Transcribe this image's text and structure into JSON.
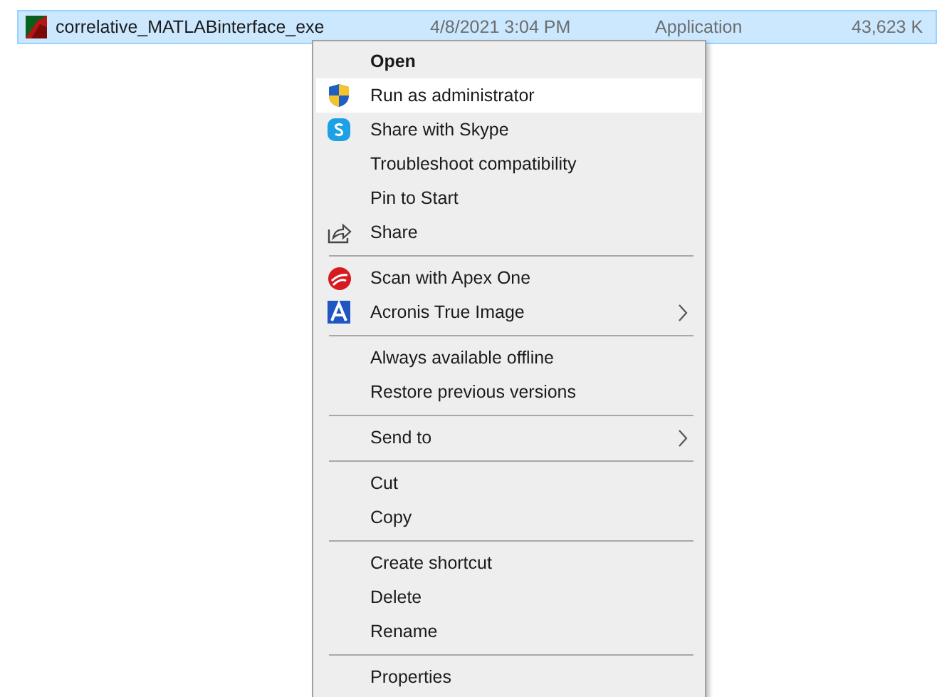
{
  "file_row": {
    "selected": true,
    "name": "correlative_MATLABinterface_exe",
    "date": "4/8/2021 3:04 PM",
    "type": "Application",
    "size": "43,623 K"
  },
  "context_menu": {
    "groups": [
      [
        {
          "label": "Open",
          "kind": "plain",
          "default": true,
          "selected": false,
          "submenu": false
        },
        {
          "label": "Run as administrator",
          "kind": "shield",
          "default": false,
          "selected": true,
          "submenu": false
        },
        {
          "label": "Share with Skype",
          "kind": "skype",
          "default": false,
          "selected": false,
          "submenu": false
        },
        {
          "label": "Troubleshoot compatibility",
          "kind": "plain",
          "default": false,
          "selected": false,
          "submenu": false
        },
        {
          "label": "Pin to Start",
          "kind": "plain",
          "default": false,
          "selected": false,
          "submenu": false
        },
        {
          "label": "Share",
          "kind": "share",
          "default": false,
          "selected": false,
          "submenu": false
        }
      ],
      [
        {
          "label": "Scan with Apex One",
          "kind": "apex",
          "default": false,
          "selected": false,
          "submenu": false
        },
        {
          "label": "Acronis True Image",
          "kind": "acronis",
          "default": false,
          "selected": false,
          "submenu": true
        }
      ],
      [
        {
          "label": "Always available offline",
          "kind": "plain",
          "default": false,
          "selected": false,
          "submenu": false
        },
        {
          "label": "Restore previous versions",
          "kind": "plain",
          "default": false,
          "selected": false,
          "submenu": false
        }
      ],
      [
        {
          "label": "Send to",
          "kind": "plain",
          "default": false,
          "selected": false,
          "submenu": true
        }
      ],
      [
        {
          "label": "Cut",
          "kind": "plain",
          "default": false,
          "selected": false,
          "submenu": false
        },
        {
          "label": "Copy",
          "kind": "plain",
          "default": false,
          "selected": false,
          "submenu": false
        }
      ],
      [
        {
          "label": "Create shortcut",
          "kind": "plain",
          "default": false,
          "selected": false,
          "submenu": false
        },
        {
          "label": "Delete",
          "kind": "plain",
          "default": false,
          "selected": false,
          "submenu": false
        },
        {
          "label": "Rename",
          "kind": "plain",
          "default": false,
          "selected": false,
          "submenu": false
        }
      ],
      [
        {
          "label": "Properties",
          "kind": "plain",
          "default": false,
          "selected": false,
          "submenu": false
        }
      ]
    ]
  }
}
